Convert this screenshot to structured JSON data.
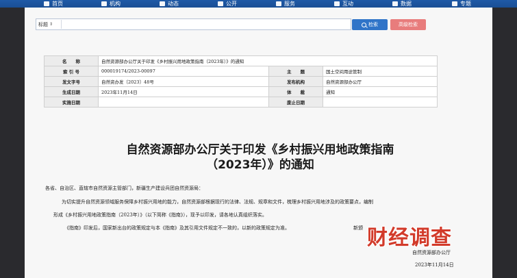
{
  "nav": {
    "items": [
      {
        "label": "首页",
        "icon": "home-icon"
      },
      {
        "label": "机构",
        "icon": "building-icon"
      },
      {
        "label": "动态",
        "icon": "news-icon"
      },
      {
        "label": "公开",
        "icon": "open-icon"
      },
      {
        "label": "服务",
        "icon": "service-icon"
      },
      {
        "label": "互动",
        "icon": "chat-icon"
      },
      {
        "label": "数据",
        "icon": "data-icon"
      },
      {
        "label": "专题",
        "icon": "topic-icon"
      }
    ]
  },
  "search": {
    "select_value": "标题",
    "placeholder": "",
    "search_label": "检索",
    "advanced_label": "高级检索"
  },
  "meta": {
    "name_label": "名　　称",
    "name_value": "自然资源部办公厅关于印发《乡村振兴用地政策指南（2023年）》的通知",
    "index_label": "索 引 号",
    "index_value": "000019174/2023-00097",
    "topic_label": "主　　题",
    "topic_value": "国土空间用途管制",
    "docno_label": "发文字号",
    "docno_value": "自然资办发〔2023〕48号",
    "issuer_label": "发布机构",
    "issuer_value": "自然资源部办公厅",
    "date_label": "生成日期",
    "date_value": "2023年11月14日",
    "genre_label": "体　　裁",
    "genre_value": "通知",
    "impl_label": "实施日期",
    "impl_value": "",
    "repeal_label": "废止日期",
    "repeal_value": ""
  },
  "doc": {
    "title_line1": "自然资源部办公厅关于印发《乡村振兴用地政策指南",
    "title_line2": "（2023年）》的通知",
    "salutation": "各省、自治区、直辖市自然资源主管部门，新疆生产建设兵团自然资源局：",
    "para1_line1": "为切实提升自然资源领域服务保障乡村振兴用地的能力，自然资源部根据现行的法律、法规、规章和文件，梳理乡村振兴用地涉及的政策要点，编制",
    "para1_line2": "形成《乡村振兴用地政策指南（2023年）》（以下简称《指南》），现予以印发，请各地认真组织落实。",
    "para2_line1": "《指南》印发后，国家新出台的政策规定与本《指南》及其引用文件规定不一致的，以新的政策规定为准。",
    "para2_tail": "新颁",
    "signature": "自然资源部办公厅",
    "sign_date": "2023年11月14日"
  },
  "watermark": {
    "text": "财经调查"
  },
  "colors": {
    "nav_bg": "#1f5aa6",
    "search_btn": "#2f74c8",
    "advanced_btn": "#e87c7c",
    "watermark": "#d23a2a"
  }
}
